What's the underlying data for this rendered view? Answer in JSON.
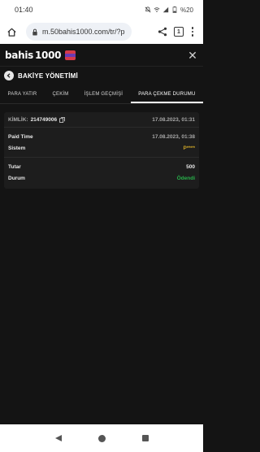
{
  "status_bar": {
    "time": "01:40",
    "battery": "%20"
  },
  "browser": {
    "url": "m.50bahis1000.com/tr/?p",
    "tab_count": "1"
  },
  "site": {
    "logo_text_a": "bahis",
    "logo_text_b": "1000"
  },
  "page": {
    "title": "BAKİYE YÖNETİMİ"
  },
  "tabs": [
    {
      "label": "PARA YATIR",
      "active": false
    },
    {
      "label": "ÇEKİM",
      "active": false
    },
    {
      "label": "İŞLEM GEÇMİŞİ",
      "active": false
    },
    {
      "label": "PARA ÇEKME DURUMU",
      "active": true
    }
  ],
  "transaction": {
    "id_label": "KİMLİK:",
    "id_value": "214749006",
    "date": "17.08.2023, 01:31",
    "paid_time_label": "Paid Time",
    "paid_time_value": "17.08.2023, 01:38",
    "system_label": "Sistem",
    "system_value": "P****",
    "amount_label": "Tutar",
    "amount_value": "500",
    "status_label": "Durum",
    "status_value": "Ödendi"
  },
  "colors": {
    "status_paid": "#28b04a",
    "system_value": "#c9a227",
    "background": "#141414",
    "card": "#1d1d1d"
  }
}
